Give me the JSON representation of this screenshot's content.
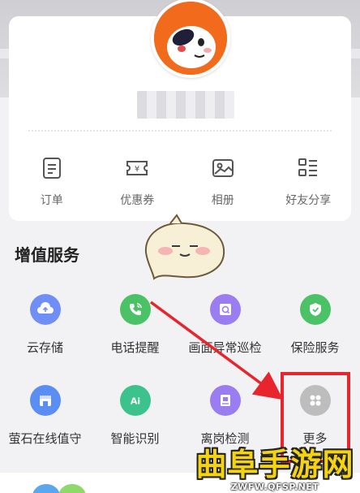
{
  "profile": {
    "quick_actions": [
      {
        "label": "订单",
        "icon": "order-icon"
      },
      {
        "label": "优惠券",
        "icon": "coupon-icon"
      },
      {
        "label": "相册",
        "icon": "album-icon"
      },
      {
        "label": "好友分享",
        "icon": "share-list-icon"
      }
    ]
  },
  "value_added": {
    "title": "增值服务",
    "services": [
      {
        "label": "云存储",
        "icon": "cloud-upload-icon",
        "color": "#6f8ef6"
      },
      {
        "label": "电话提醒",
        "icon": "phone-call-icon",
        "color": "#4cc266"
      },
      {
        "label": "画面异常巡检",
        "icon": "camera-inspect-icon",
        "color": "#9b7df2"
      },
      {
        "label": "保险服务",
        "icon": "shield-check-icon",
        "color": "#4cc266"
      },
      {
        "label": "萤石在线值守",
        "icon": "guard-box-icon",
        "color": "#5a8ef2"
      },
      {
        "label": "智能识别",
        "icon": "ai-icon",
        "color": "#3cc28c"
      },
      {
        "label": "离岗检测",
        "icon": "post-detect-icon",
        "color": "#9b7df2"
      },
      {
        "label": "更多",
        "icon": "more-grid-icon",
        "color": "#bdbdbd"
      }
    ]
  },
  "watermark": {
    "main": "曲阜手游网",
    "sub": "ZWFW.QFSP.NET"
  },
  "colors": {
    "highlight": "#e8242c",
    "avatar": "#f26b1d"
  }
}
